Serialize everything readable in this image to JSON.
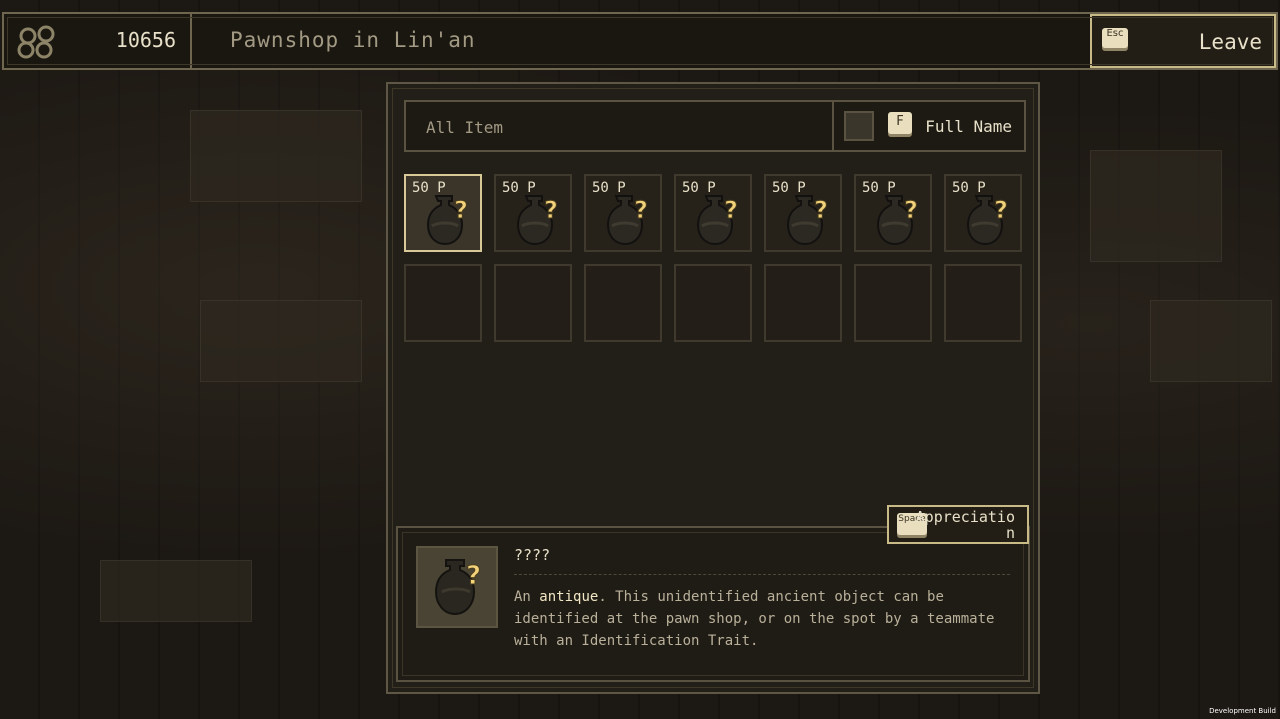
{
  "header": {
    "coins": "10656",
    "shop_title": "Pawnshop in Lin'an",
    "leave_key": "Esc",
    "leave_label": "Leave"
  },
  "filter": {
    "label": "All Item",
    "toggle_key": "F",
    "toggle_label": "Full Name"
  },
  "inventory": {
    "items": [
      {
        "price": "50 P",
        "icon": "unidentified-antique-icon",
        "selected": true
      },
      {
        "price": "50 P",
        "icon": "unidentified-antique-icon"
      },
      {
        "price": "50 P",
        "icon": "unidentified-antique-icon"
      },
      {
        "price": "50 P",
        "icon": "unidentified-antique-icon"
      },
      {
        "price": "50 P",
        "icon": "unidentified-antique-icon"
      },
      {
        "price": "50 P",
        "icon": "unidentified-antique-icon"
      },
      {
        "price": "50 P",
        "icon": "unidentified-antique-icon"
      }
    ]
  },
  "details": {
    "action_key": "Space",
    "action_label": "Appreciation",
    "item_name": "????",
    "desc_prefix": "An ",
    "desc_highlight": "antique",
    "desc_rest": ". This unidentified ancient object can be identified at the pawn shop, or on the spot by a teammate with an Identification Trait."
  },
  "footer": {
    "build_label": "Development Build"
  },
  "colors": {
    "accent": "#d8c998",
    "panel_bg": "#221f18",
    "text": "#e8e0c8"
  }
}
